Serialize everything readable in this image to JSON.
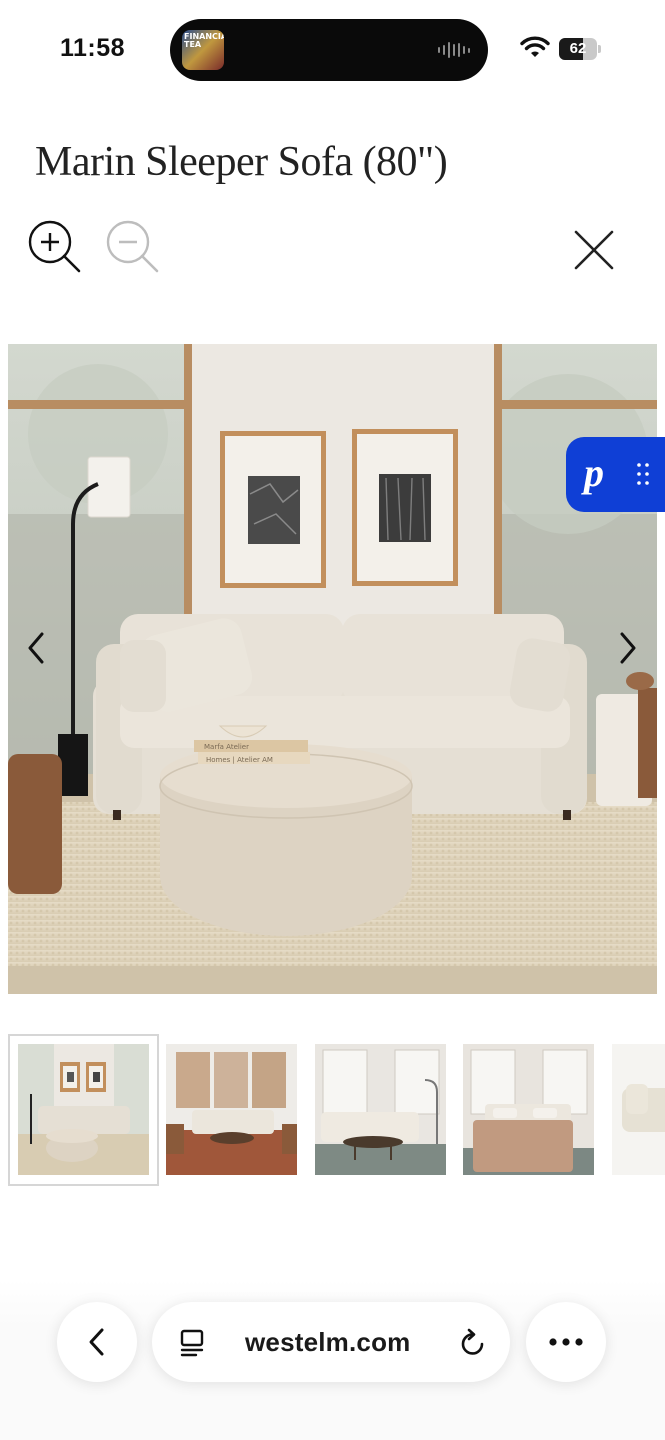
{
  "status_bar": {
    "time": "11:58",
    "now_playing_art_text": "FINANCIAL TEA",
    "battery_level": "62",
    "battery_fraction": 0.62
  },
  "product": {
    "title": "Marin Sleeper Sofa (80\")"
  },
  "toolbar": {
    "zoom_in_icon": "zoom-in-icon",
    "zoom_out_icon": "zoom-out-icon",
    "close_icon": "close-icon"
  },
  "gallery": {
    "selected_index": 0,
    "thumbnail_count_visible": 5,
    "book_top_text": "Marfa Atelier",
    "book_bottom_text": "Homes | Atelier AM"
  },
  "pinterest": {
    "letter": "p",
    "color": "#0f3fd6"
  },
  "browser": {
    "url": "westelm.com",
    "back_icon": "chevron-left-icon",
    "reader_icon": "reader-mode-icon",
    "reload_icon": "reload-icon",
    "more_icon": "more-icon"
  }
}
